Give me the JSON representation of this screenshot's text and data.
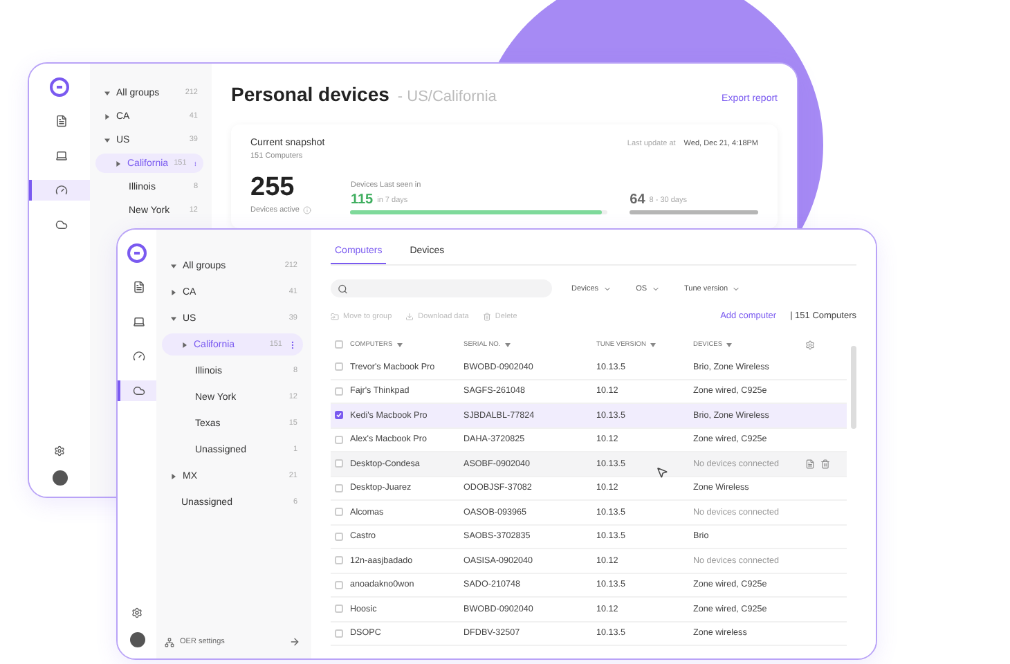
{
  "back_window": {
    "nav": [
      {
        "selected": false
      },
      {
        "selected": false
      },
      {
        "selected": true
      },
      {
        "selected": false
      }
    ],
    "groups": [
      {
        "label": "All groups",
        "count": "212",
        "kind": "group",
        "expanded": true,
        "selected": false
      },
      {
        "label": "CA",
        "count": "41",
        "kind": "group",
        "expanded": false,
        "selected": false
      },
      {
        "label": "US",
        "count": "39",
        "kind": "group",
        "expanded": true,
        "selected": false
      },
      {
        "label": "California",
        "count": "151",
        "kind": "subgroup",
        "expanded": false,
        "selected": true
      },
      {
        "label": "Illinois",
        "count": "8",
        "kind": "leaf",
        "selected": false
      },
      {
        "label": "New York",
        "count": "12",
        "kind": "leaf",
        "selected": false
      }
    ],
    "title": "Personal devices",
    "subtitle": "- US/California",
    "export": "Export report",
    "snapshot": {
      "title": "Current snapshot",
      "subtitle": "151 Computers",
      "last_update_label": "Last update at",
      "last_update": "Wed, Dec 21, 4:18PM",
      "active": "255",
      "active_label": "Devices active",
      "seen_label": "Devices Last seen in",
      "meters": [
        {
          "value": "115",
          "caption": "in 7 days",
          "level": 0.98,
          "color": "#7ed99a"
        },
        {
          "value": "64",
          "caption": "8 - 30 days",
          "level": 1,
          "color": "#b5b5b5"
        }
      ]
    }
  },
  "front_window": {
    "nav": [
      {
        "selected": false
      },
      {
        "selected": false
      },
      {
        "selected": false
      },
      {
        "selected": true
      }
    ],
    "groups": [
      {
        "label": "All groups",
        "count": "212",
        "kind": "group",
        "expanded": true,
        "selected": false
      },
      {
        "label": "CA",
        "count": "41",
        "kind": "group",
        "expanded": false,
        "selected": false
      },
      {
        "label": "US",
        "count": "39",
        "kind": "group",
        "expanded": true,
        "selected": false
      },
      {
        "label": "California",
        "count": "151",
        "kind": "subgroup",
        "expanded": false,
        "selected": true
      },
      {
        "label": "Illinois",
        "count": "8",
        "kind": "leaf",
        "selected": false
      },
      {
        "label": "New York",
        "count": "12",
        "kind": "leaf",
        "selected": false
      },
      {
        "label": "Texas",
        "count": "15",
        "kind": "leaf",
        "selected": false
      },
      {
        "label": "Unassigned",
        "count": "1",
        "kind": "leaf",
        "selected": false
      },
      {
        "label": "MX",
        "count": "21",
        "kind": "group",
        "expanded": false,
        "selected": false
      },
      {
        "label": "Unassigned",
        "count": "6",
        "kind": "topleaf",
        "selected": false
      }
    ],
    "settings_link": "OER settings",
    "tabs": [
      {
        "label": "Computers",
        "selected": true
      },
      {
        "label": "Devices",
        "selected": false
      }
    ],
    "filters": [
      "Devices",
      "OS",
      "Tune version"
    ],
    "actions": [
      {
        "label": "Move to group",
        "disabled": true
      },
      {
        "label": "Download data",
        "disabled": true
      },
      {
        "label": "Delete",
        "disabled": true
      }
    ],
    "add_computer": "Add computer",
    "total": "| 151 Computers",
    "select_all": {
      "checked": false
    },
    "columns": [
      "COMPUTERS",
      "SERIAL NO.",
      "TUNE VERSION",
      "DEVICES"
    ],
    "rows": [
      {
        "cells": [
          "Trevor's Macbook Pro",
          "BWOBD-0902040",
          "10.13.5",
          "Brio, Zone Wireless"
        ],
        "checked": false,
        "hovered": false,
        "muted": false
      },
      {
        "cells": [
          "Fajr's Thinkpad",
          "SAGFS-261048",
          "10.12",
          "Zone wired, C925e"
        ],
        "checked": false,
        "hovered": false,
        "muted": false
      },
      {
        "cells": [
          "Kedi's Macbook Pro",
          "SJBDALBL-77824",
          "10.13.5",
          "Brio, Zone Wireless"
        ],
        "checked": true,
        "hovered": false,
        "muted": false
      },
      {
        "cells": [
          "Alex's Macbook Pro",
          "DAHA-3720825",
          "10.12",
          "Zone wired, C925e"
        ],
        "checked": false,
        "hovered": false,
        "muted": false
      },
      {
        "cells": [
          "Desktop-Condesa",
          "ASOBF-0902040",
          "10.13.5",
          "No devices connected"
        ],
        "checked": false,
        "hovered": true,
        "muted": true
      },
      {
        "cells": [
          "Desktop-Juarez",
          "ODOBJSF-37082",
          "10.12",
          "Zone Wireless"
        ],
        "checked": false,
        "hovered": false,
        "muted": false
      },
      {
        "cells": [
          "Alcomas",
          "OASOB-093965",
          "10.13.5",
          "No devices connected"
        ],
        "checked": false,
        "hovered": false,
        "muted": true
      },
      {
        "cells": [
          "Castro",
          "SAOBS-3702835",
          "10.13.5",
          "Brio"
        ],
        "checked": false,
        "hovered": false,
        "muted": false
      },
      {
        "cells": [
          "12n-aasjbadado",
          "OASISA-0902040",
          "10.12",
          "No devices connected"
        ],
        "checked": false,
        "hovered": false,
        "muted": true
      },
      {
        "cells": [
          "anoadakno0won",
          "SADO-210748",
          "10.13.5",
          "Zone wired, C925e"
        ],
        "checked": false,
        "hovered": false,
        "muted": false
      },
      {
        "cells": [
          "Hoosic",
          "BWOBD-0902040",
          "10.12",
          "Zone wired, C925e"
        ],
        "checked": false,
        "hovered": false,
        "muted": false
      },
      {
        "cells": [
          "DSOPC",
          "DFDBV-32507",
          "10.13.5",
          "Zone wireless"
        ],
        "checked": false,
        "hovered": false,
        "muted": false
      }
    ]
  }
}
